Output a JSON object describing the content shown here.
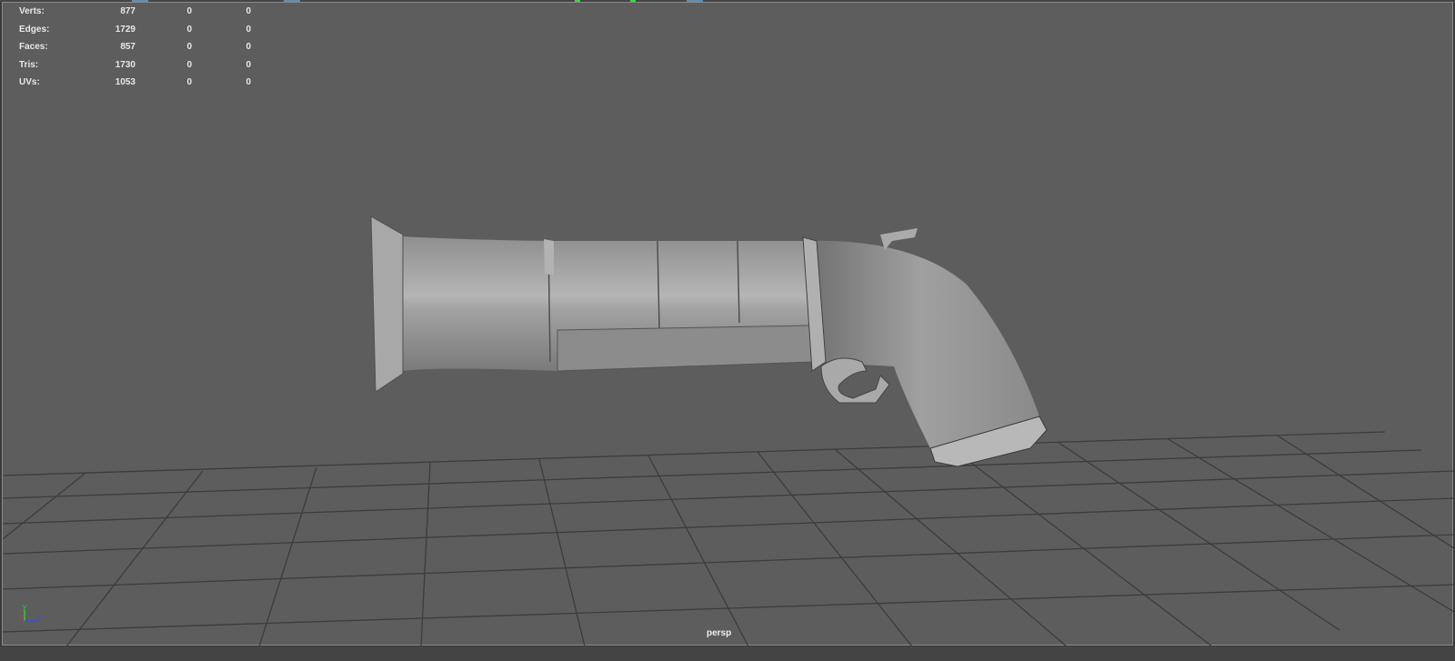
{
  "hud": {
    "rows": [
      {
        "label": "Verts:",
        "a": "877",
        "b": "0",
        "c": "0"
      },
      {
        "label": "Edges:",
        "a": "1729",
        "b": "0",
        "c": "0"
      },
      {
        "label": "Faces:",
        "a": "857",
        "b": "0",
        "c": "0"
      },
      {
        "label": "Tris:",
        "a": "1730",
        "b": "0",
        "c": "0"
      },
      {
        "label": "UVs:",
        "a": "1053",
        "b": "0",
        "c": "0"
      }
    ]
  },
  "axis": {
    "x": "x",
    "y": "y",
    "z": "z",
    "x_color": "#e03030",
    "y_color": "#30d030",
    "z_color": "#3050f0"
  },
  "camera": "persp",
  "colors": {
    "viewport": "#5d5d5d",
    "grid": "#3f3f3f",
    "model": "#9a9a9a"
  }
}
